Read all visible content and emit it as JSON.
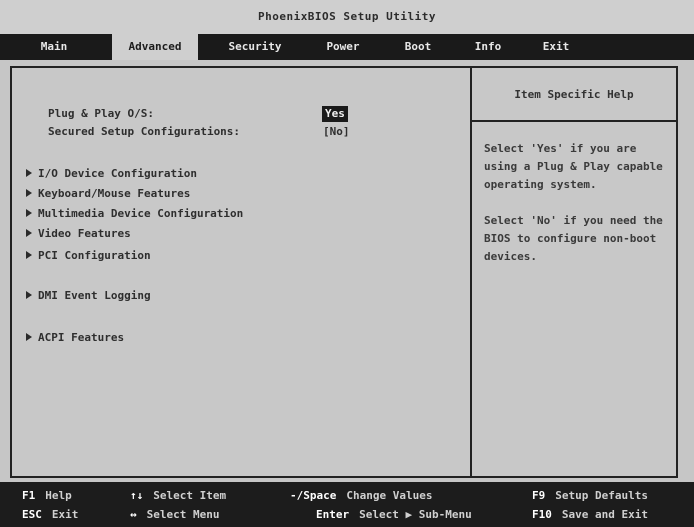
{
  "title": "PhoenixBIOS Setup Utility",
  "menu": {
    "items": [
      "Main",
      "Advanced",
      "Security",
      "Power",
      "Boot",
      "Info",
      "Exit"
    ],
    "selected": "Advanced"
  },
  "options": [
    {
      "label": "Plug & Play O/S:",
      "value": "Yes",
      "active": true
    },
    {
      "label": "Secured Setup Configurations:",
      "value": "[No]",
      "active": false
    }
  ],
  "submenus": [
    "I/O Device Configuration",
    "Keyboard/Mouse Features",
    "Multimedia Device Configuration",
    "Video Features",
    "PCI Configuration",
    "DMI Event Logging",
    "ACPI Features"
  ],
  "help": {
    "header": "Item Specific Help",
    "para1": "Select 'Yes' if you are using a Plug & Play capable operating system.",
    "para2": "Select 'No' if you need the BIOS to configure non-boot devices."
  },
  "footer": [
    {
      "key": "F1",
      "desc": "Help"
    },
    {
      "key": "↑↓",
      "desc": "Select Item"
    },
    {
      "key": "-/Space",
      "desc": "Change Values"
    },
    {
      "key": "F9",
      "desc": "Setup Defaults"
    },
    {
      "key": "ESC",
      "desc": "Exit"
    },
    {
      "key": "↔",
      "desc": "Select Menu"
    },
    {
      "key": "Enter",
      "desc": "Select ▶ Sub-Menu"
    },
    {
      "key": "F10",
      "desc": "Save and Exit"
    }
  ],
  "colors": {
    "background": "#c6c6c6",
    "menu_bar": "#1a1a1a",
    "selected_value_bg": "#1a1a1a"
  }
}
